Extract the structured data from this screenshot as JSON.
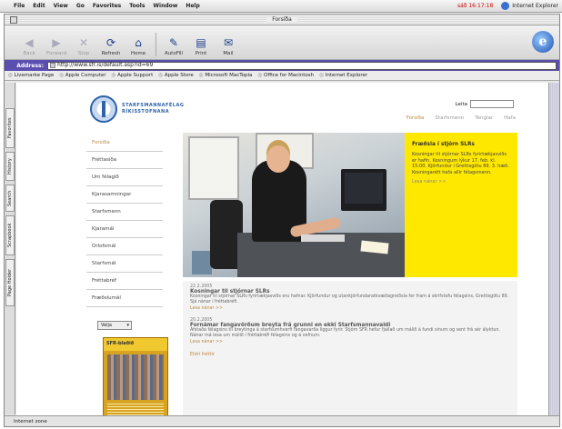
{
  "menubar": {
    "items": [
      "File",
      "Edit",
      "View",
      "Go",
      "Favorites",
      "Tools",
      "Window",
      "Help"
    ],
    "clock": "sáð 16:17:18",
    "app": "Internet Explorer"
  },
  "window": {
    "title": "Forsíða"
  },
  "toolbar": {
    "buttons": [
      {
        "label": "Back",
        "icon": "back-arrow-icon"
      },
      {
        "label": "Forward",
        "icon": "forward-arrow-icon"
      },
      {
        "label": "Stop",
        "icon": "stop-icon"
      },
      {
        "label": "Refresh",
        "icon": "refresh-icon"
      },
      {
        "label": "Home",
        "icon": "home-icon"
      },
      {
        "label": "AutoFill",
        "icon": "autofill-icon"
      },
      {
        "label": "Print",
        "icon": "print-icon"
      },
      {
        "label": "Mail",
        "icon": "mail-icon"
      }
    ]
  },
  "address": {
    "label": "Address:",
    "url": "http://www.sfr.is/default.asp?id=69"
  },
  "links": [
    "Livemarke Page",
    "Apple Computer",
    "Apple Support",
    "Apple Store",
    "Microsoft MacTopia",
    "Office for Macintosh",
    "Internet Explorer"
  ],
  "sidetabs": [
    "Favorites",
    "History",
    "Search",
    "Scrapbook",
    "Page Holder"
  ],
  "site": {
    "logo_line1": "STARFSMANNAFÉLAG",
    "logo_line2": "RÍKISSTOFNANA",
    "search_label": "Leita",
    "topnav": [
      "Forsíða",
      "Starfsmenn",
      "Tenglar",
      "Hafa"
    ],
    "leftnav": [
      "Forsíða",
      "Fréttasíða",
      "Um félagið",
      "Kjarasamningar",
      "Starfsmenn",
      "Kjaramál",
      "Orlofsmál",
      "Starfsmál",
      "Fréttabréf",
      "Fræðslumál"
    ],
    "select_value": "Velja",
    "magazine_title": "SFR-blaðið",
    "promo": {
      "title": "Fræðsla í stjórn SLRs",
      "body": "Kosningar til stjórnar SLRs fyrirtækjasviðs er hafin. Kosningum lýkur 17. feb. kl. 15:00. Kjörfundur í Grettisgötu 89, 3. hæð. Kosningarétt hafa allir félagsmenn.",
      "more": "Lesa nánar >>"
    },
    "news": [
      {
        "date": "22.2.2005",
        "title": "Kosningar til stjórnar SLRs",
        "body": "Kosningar til stjórnar SLRs fyrirtækjasviðs eru hafnar. Kjörfundur og utankjörfundaratkvæðagreiðsla fer fram á skrifstofu félagsins, Grettisgötu 89. Sjá nánar í fréttabréfi.",
        "more": "Lesa nánar >>"
      },
      {
        "date": "20.2.2005",
        "title": "Fornámar fangavörðum breyta frá grunni en ekki Starfsmannavaldi",
        "body": "Afstaða félagsins til breytinga á starfsumhverfi fangavarða liggur fyrir. Stjórn SFR hefur fjallað um málið á fundi sínum og sent frá sér ályktun. Nánar má lesa um málið í fréttabréfi félagsins og á vefnum.",
        "more": "Lesa nánar >>"
      }
    ],
    "news_all": "Eldri fréttir"
  },
  "status": "Internet zone"
}
